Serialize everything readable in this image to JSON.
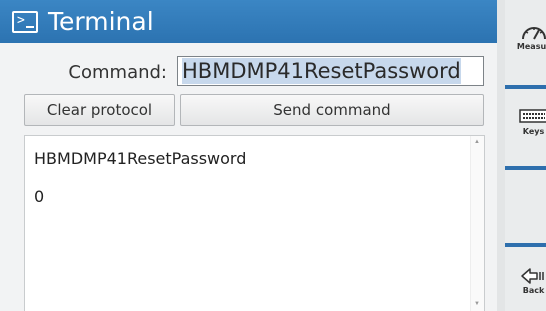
{
  "window": {
    "title": "Terminal",
    "icon": "terminal-icon"
  },
  "command": {
    "label": "Command:",
    "value": "HBMDMP41ResetPassword"
  },
  "buttons": {
    "clear": "Clear protocol",
    "send": "Send command"
  },
  "protocol": {
    "lines": [
      "HBMDMP41ResetPassword",
      "0"
    ]
  },
  "side_panel": {
    "measure": {
      "label": "Measur",
      "icon": "gauge-icon"
    },
    "keys": {
      "label": "Keys",
      "icon": "keyboard-icon"
    },
    "back": {
      "label": "Back",
      "icon": "back-arrow-icon"
    }
  },
  "colors": {
    "titlebar": "#2f78b8",
    "selection": "#c7d8ec",
    "separator": "#2e6fad"
  }
}
